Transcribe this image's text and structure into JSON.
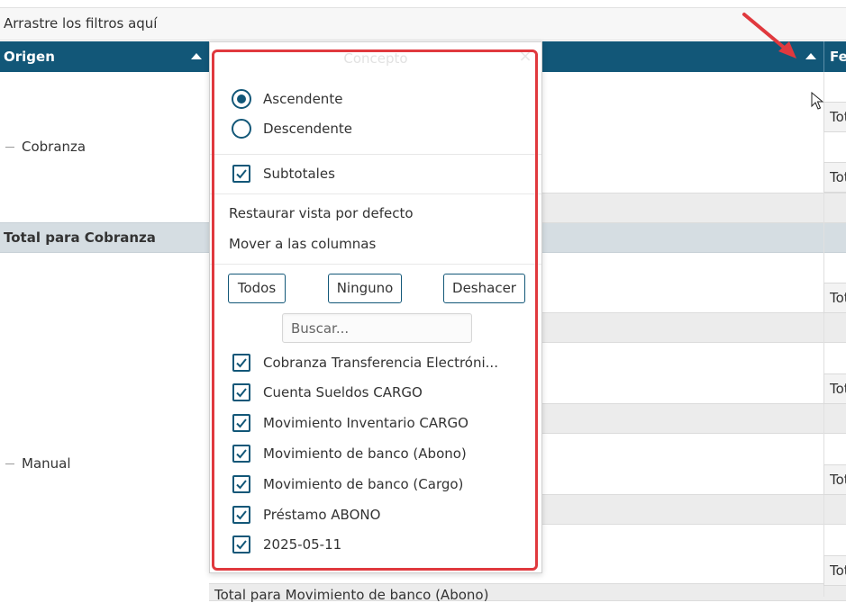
{
  "filter_area": {
    "text": "Arrastre los filtros aquí"
  },
  "header": {
    "origen_label": "Origen",
    "right_column_label": "Fe",
    "accent_color": "#125778"
  },
  "rows": {
    "cobranza_label": "Cobranza",
    "total_cobranza_label": "Total para Cobranza",
    "manual_label": "Manual",
    "tot_label": "Tot",
    "bottom_label": "Total para Movimiento de banco (Abono)"
  },
  "popup": {
    "title": "Concepto",
    "close_icon": "×",
    "sort_options": [
      {
        "label": "Ascendente",
        "checked": true
      },
      {
        "label": "Descendente",
        "checked": false
      }
    ],
    "subtotals": {
      "label": "Subtotales",
      "checked": true
    },
    "restore_label": "Restaurar vista por defecto",
    "move_label": "Mover a las columnas",
    "buttons": {
      "all": "Todos",
      "none": "Ninguno",
      "undo": "Deshacer"
    },
    "search": {
      "placeholder": "Buscar...",
      "value": ""
    },
    "items": [
      {
        "label": "Cobranza Transferencia Electróni...",
        "checked": true
      },
      {
        "label": "Cuenta Sueldos CARGO",
        "checked": true
      },
      {
        "label": "Movimiento Inventario CARGO",
        "checked": true
      },
      {
        "label": "Movimiento de banco (Abono)",
        "checked": true
      },
      {
        "label": "Movimiento de banco (Cargo)",
        "checked": true
      },
      {
        "label": "Préstamo ABONO",
        "checked": true
      },
      {
        "label": "2025-05-11",
        "checked": true
      }
    ]
  },
  "annotation": {
    "highlight_color": "#e0393e"
  }
}
